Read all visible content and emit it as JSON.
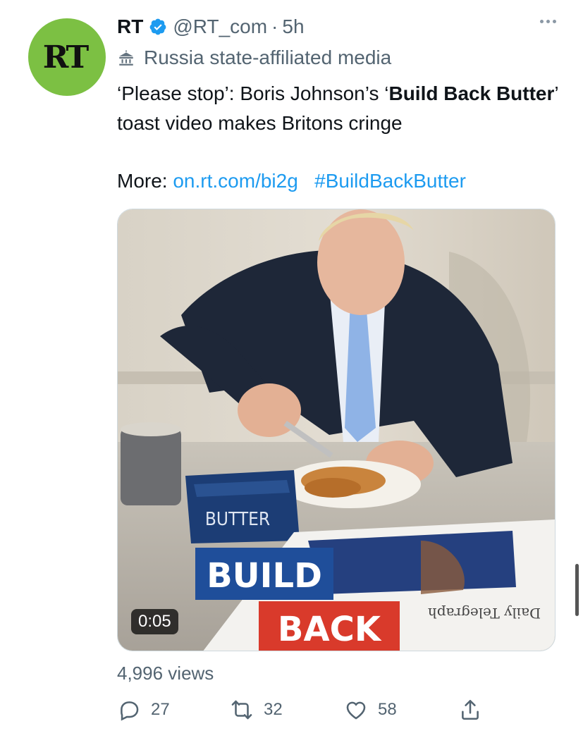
{
  "tweet": {
    "avatar_text": "RT",
    "author_name": "RT",
    "handle": "@RT_com",
    "separator": "·",
    "time": "5h",
    "affiliation": "Russia state-affiliated media",
    "text_part1": "‘Please stop’: Boris Johnson’s ‘",
    "text_bold1": "Build Back Butter",
    "text_part2": "’ toast video makes Britons cringe",
    "more_label": "More: ",
    "link_url": "on.rt.com/bi2g",
    "hashtag": "#BuildBackButter"
  },
  "video": {
    "duration": "0:05",
    "butter_dish_label": "BUTTER",
    "caption_build": "BUILD",
    "caption_back": "BACK",
    "newspaper_masthead": "Daily Telegraph",
    "views": "4,996 views"
  },
  "actions": {
    "reply_count": "27",
    "retweet_count": "32",
    "like_count": "58"
  },
  "colors": {
    "accent": "#1d9bf0",
    "avatar_bg": "#7cc043",
    "caption_build_bg": "#1f4e9a",
    "caption_back_bg": "#d93a2b"
  },
  "icons": [
    "verified-icon",
    "more-icon",
    "state-media-icon",
    "reply-icon",
    "retweet-icon",
    "like-icon",
    "share-icon"
  ]
}
